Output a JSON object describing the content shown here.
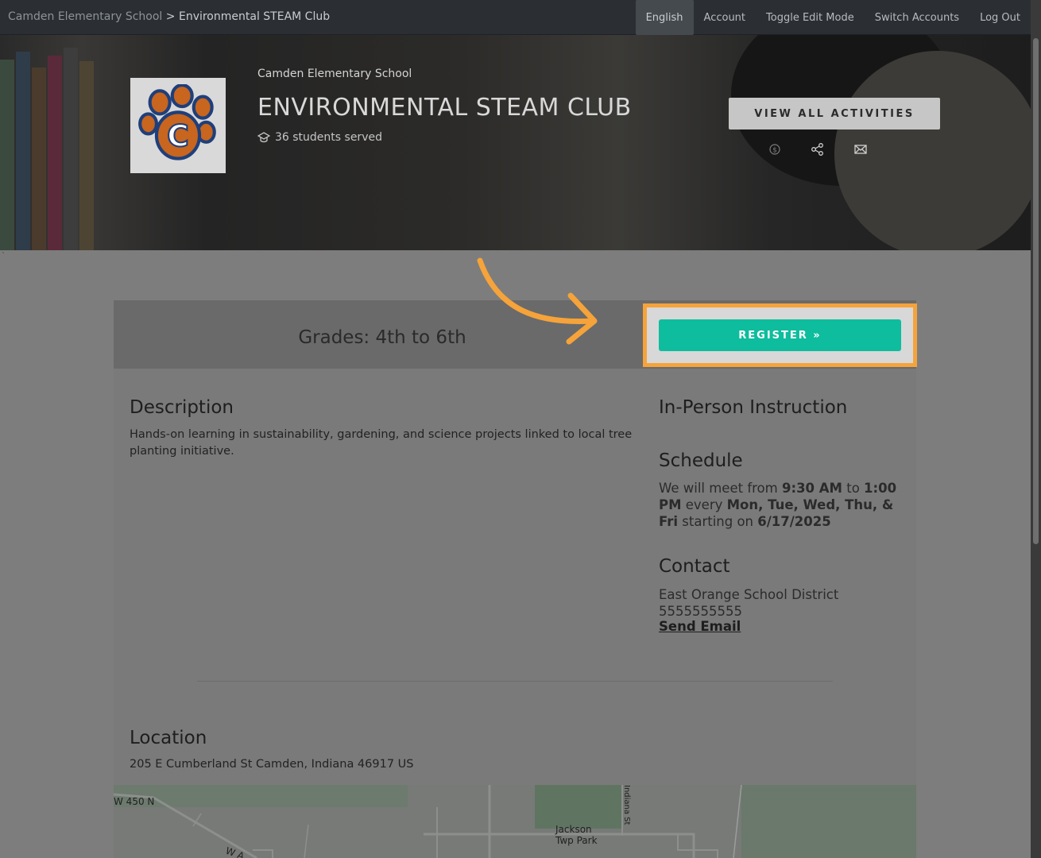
{
  "breadcrumb": {
    "school": "Camden Elementary School",
    "separator": ">",
    "current": "Environmental STEAM Club"
  },
  "nav": {
    "items": [
      "English",
      "Account",
      "Toggle Edit Mode",
      "Switch Accounts",
      "Log Out"
    ],
    "active": "English"
  },
  "hero": {
    "school_name": "Camden Elementary School",
    "title": "ENVIRONMENTAL STEAM CLUB",
    "students_served": "36 students served",
    "view_all_label": "VIEW ALL ACTIVITIES",
    "icons": [
      "dollar-icon",
      "share-icon",
      "mail-icon"
    ]
  },
  "activity": {
    "grades": "Grades: 4th to 6th",
    "register_label": "REGISTER »",
    "description_heading": "Description",
    "description_text": "Hands-on learning in sustainability, gardening, and science projects linked to local tree planting initiative.",
    "instruction_heading": "In-Person Instruction",
    "schedule_heading": "Schedule",
    "schedule": {
      "prefix": "We will meet from",
      "start_time": "9:30 AM",
      "to": "to",
      "end_time": "1:00 PM",
      "every": "every",
      "days": "Mon, Tue, Wed, Thu, & Fri",
      "starting_on": "starting on",
      "start_date": "6/17/2025"
    },
    "contact_heading": "Contact",
    "contact_name": "East Orange School District",
    "contact_phone": "5555555555",
    "send_email_label": "Send Email",
    "location_heading": "Location",
    "location_address": "205 E Cumberland St Camden, Indiana 46917 US"
  },
  "map": {
    "labels": [
      "W 450 N",
      "Jackson",
      "Twp Park",
      "Indiana St",
      "W A"
    ]
  },
  "colors": {
    "register": "#0dbd9d",
    "highlight": "#f5a33a",
    "topbar": "#2b2f33"
  }
}
